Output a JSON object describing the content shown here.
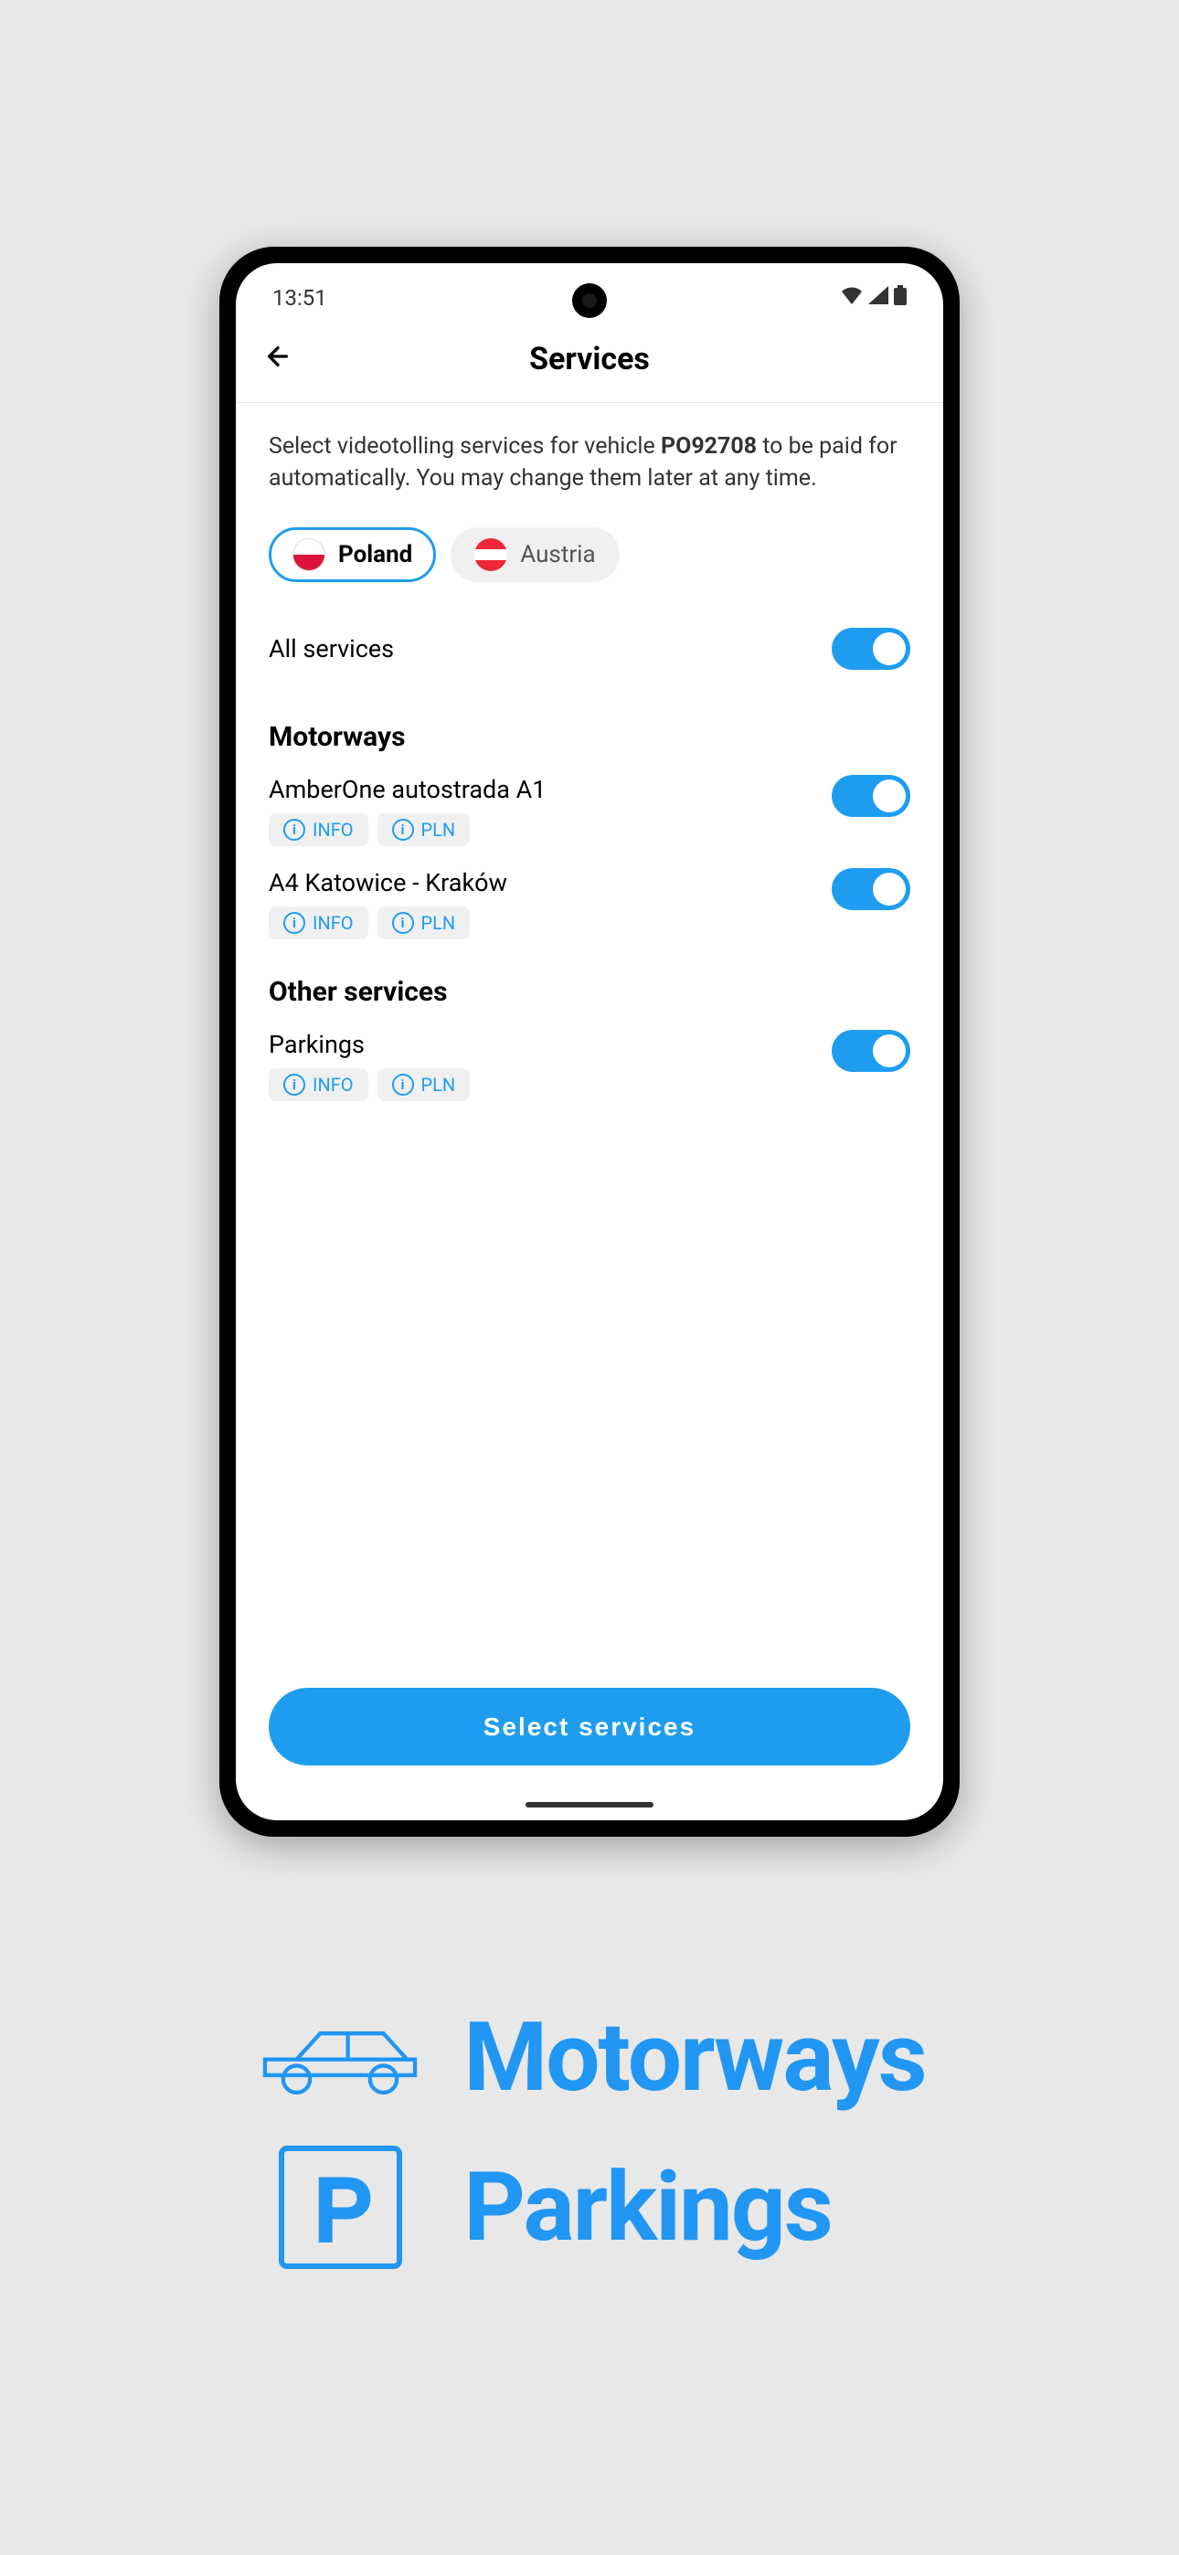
{
  "status_bar": {
    "time": "13:51"
  },
  "header": {
    "title": "Services"
  },
  "intro": {
    "text_before": "Select videotolling services for vehicle ",
    "vehicle_id": "PO92708",
    "text_after": " to be paid for automatically. You may change them later at any time."
  },
  "countries": [
    {
      "label": "Poland",
      "active": true
    },
    {
      "label": "Austria",
      "active": false
    }
  ],
  "all_services": {
    "label": "All services",
    "enabled": true
  },
  "sections": {
    "motorways": {
      "title": "Motorways",
      "items": [
        {
          "name": "AmberOne autostrada A1",
          "info_label": "INFO",
          "pln_label": "PLN",
          "enabled": true
        },
        {
          "name": "A4 Katowice - Kraków",
          "info_label": "INFO",
          "pln_label": "PLN",
          "enabled": true
        }
      ]
    },
    "other": {
      "title": "Other services",
      "items": [
        {
          "name": "Parkings",
          "info_label": "INFO",
          "pln_label": "PLN",
          "enabled": true
        }
      ]
    }
  },
  "footer": {
    "button_label": "Select services"
  },
  "promo": {
    "row1": "Motorways",
    "row2": "Parkings"
  }
}
